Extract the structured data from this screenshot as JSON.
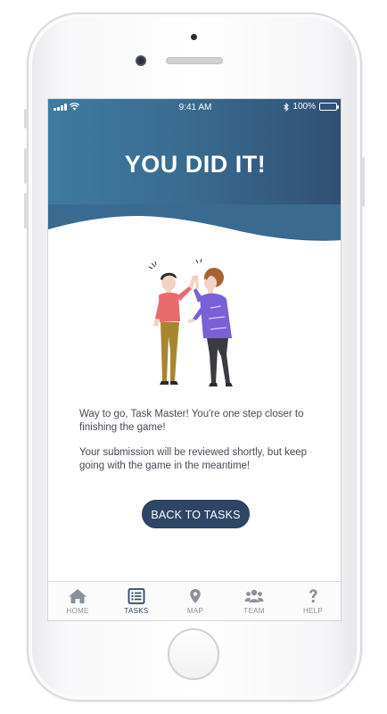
{
  "status_bar": {
    "time": "9:41 AM",
    "battery": "100%",
    "battery_level": 1.0
  },
  "hero": {
    "title": "YOU DID IT!"
  },
  "message": {
    "line1": "Way to go, Task Master! You're one step closer to finishing the game!",
    "line2": "Your submission will be reviewed shortly, but keep going with the game in the meantime!"
  },
  "back_button": {
    "label": "BACK TO TASKS"
  },
  "tabs": [
    {
      "label": "HOME",
      "icon": "home-icon",
      "active": false
    },
    {
      "label": "TASKS",
      "icon": "list-icon",
      "active": true
    },
    {
      "label": "MAP",
      "icon": "map-pin-icon",
      "active": false
    },
    {
      "label": "TEAM",
      "icon": "team-icon",
      "active": false
    },
    {
      "label": "HELP",
      "icon": "question-icon",
      "active": false
    }
  ],
  "colors": {
    "hero_start": "#3f7aa0",
    "hero_end": "#314f73",
    "button": "#2e4566",
    "tab_inactive": "#8b9099",
    "tab_active": "#2e4566"
  }
}
